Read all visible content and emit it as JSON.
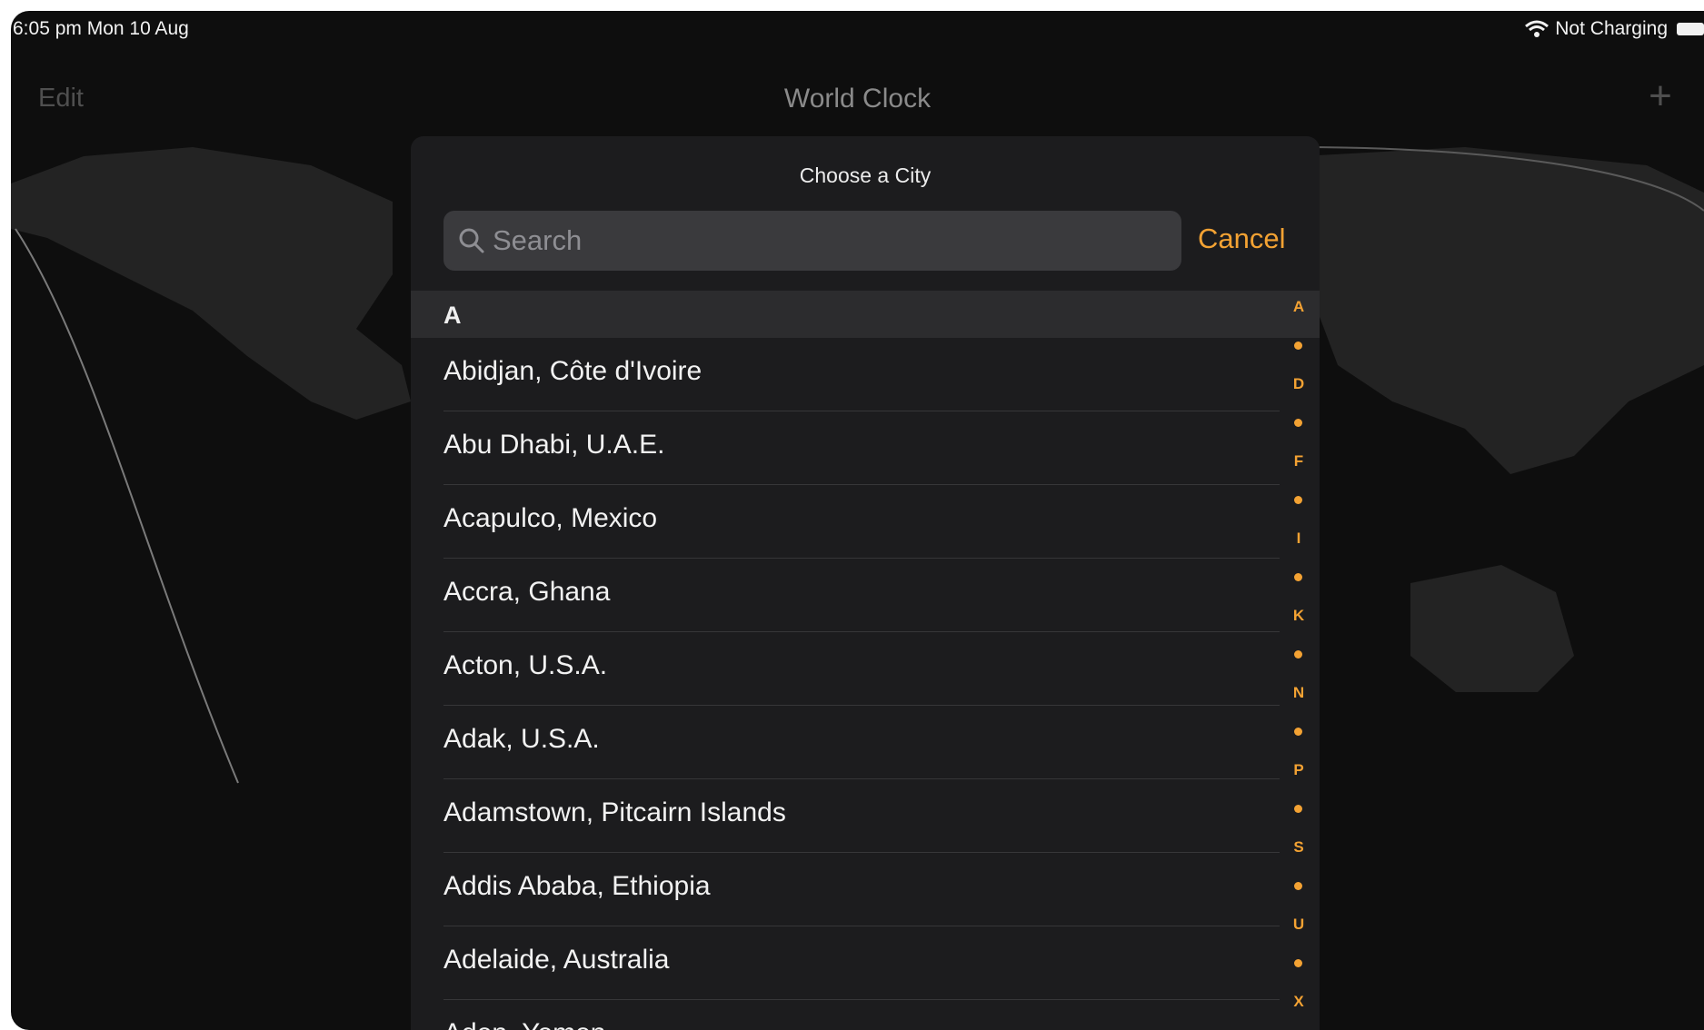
{
  "status_bar": {
    "time_date": "6:05 pm   Mon 10 Aug",
    "charging_status": "Not Charging"
  },
  "nav": {
    "edit_label": "Edit",
    "title": "World Clock",
    "add_icon": "plus-icon"
  },
  "modal": {
    "title": "Choose a City",
    "search_placeholder": "Search",
    "cancel_label": "Cancel",
    "section_header": "A",
    "cities": [
      "Abidjan, Côte d'Ivoire",
      "Abu Dhabi, U.A.E.",
      "Acapulco, Mexico",
      "Accra, Ghana",
      "Acton, U.S.A.",
      "Adak, U.S.A.",
      "Adamstown, Pitcairn Islands",
      "Addis Ababa, Ethiopia",
      "Adelaide, Australia",
      "Aden, Yemen"
    ],
    "index_letters": [
      "A",
      "D",
      "F",
      "I",
      "K",
      "N",
      "P",
      "S",
      "U",
      "X"
    ]
  },
  "colors": {
    "accent": "#f3a233",
    "modal_bg": "#1c1c1e",
    "section_bg": "#2c2c2e",
    "search_bg": "#3a3a3d"
  }
}
